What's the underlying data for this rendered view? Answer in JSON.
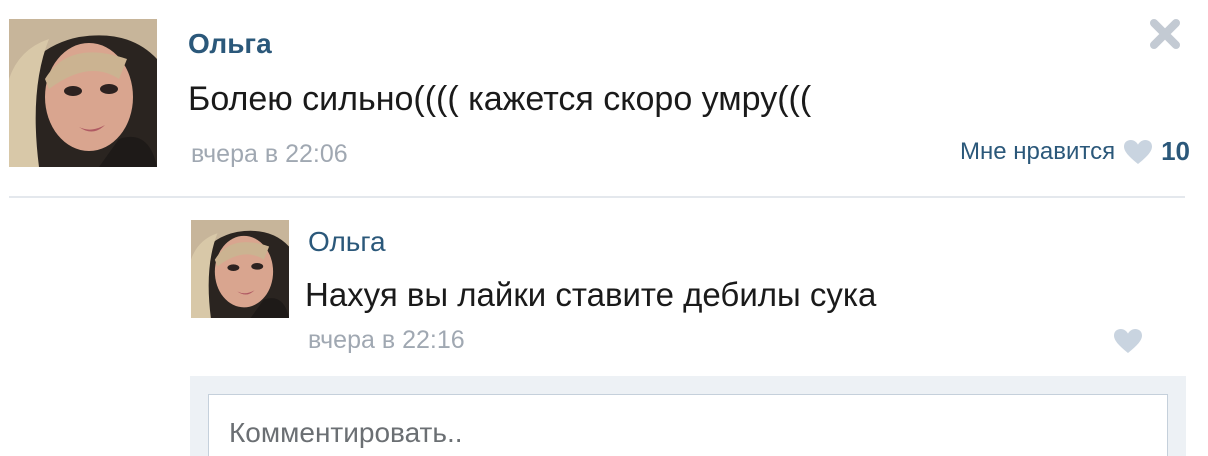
{
  "post": {
    "author": "Ольга",
    "text": "Болею сильно(((( кажется скоро умру(((",
    "date": "вчера в 22:06",
    "like_label": "Мне нравится",
    "like_count": "10",
    "close_icon": "close-icon",
    "heart_icon": "heart-icon"
  },
  "reply": {
    "author": "Ольга",
    "text": "Нахуя вы лайки ставите дебилы сука",
    "date": "вчера в 22:16",
    "heart_icon": "heart-icon"
  },
  "comment": {
    "placeholder": "Комментировать.."
  },
  "colors": {
    "link": "#2b587a",
    "muted": "#a0a8b2",
    "heart": "#c9d4e0",
    "comment_bg": "#edf1f5"
  }
}
